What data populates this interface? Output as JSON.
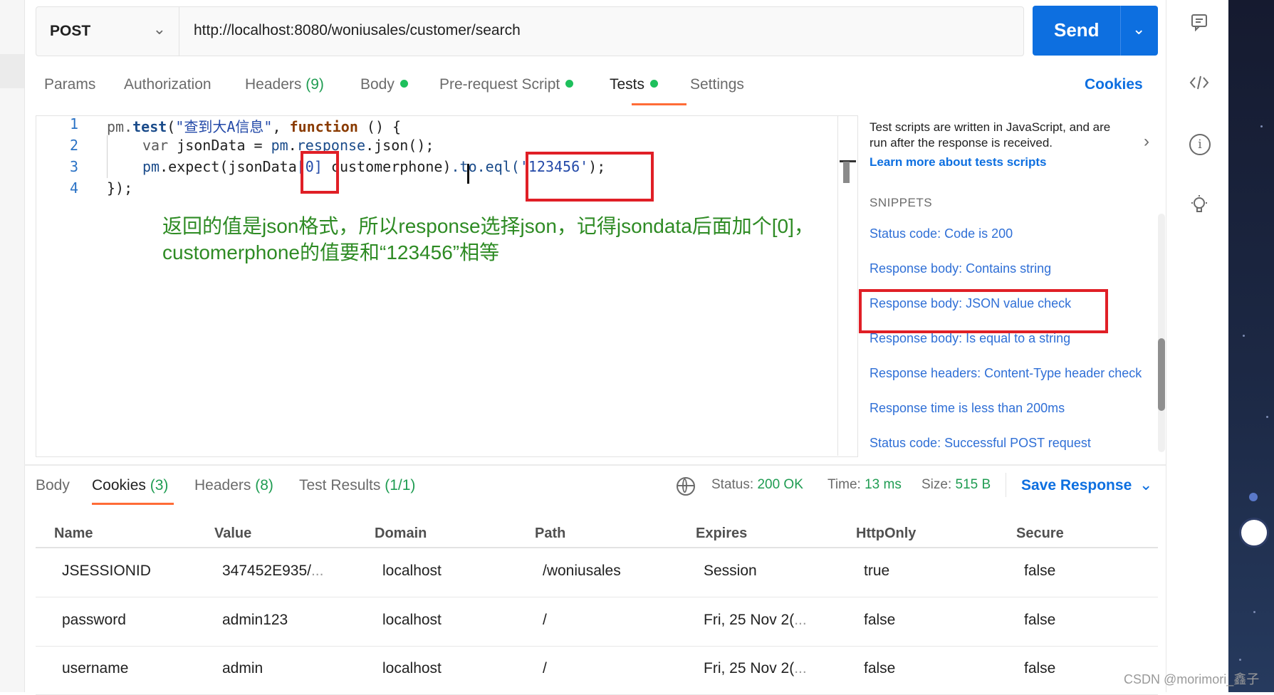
{
  "request": {
    "method": "POST",
    "url": "http://localhost:8080/woniusales/customer/search",
    "send_label": "Send"
  },
  "request_tabs": {
    "params": "Params",
    "authorization": "Authorization",
    "headers": "Headers",
    "headers_count": "(9)",
    "body": "Body",
    "prerequest": "Pre-request Script",
    "tests": "Tests",
    "settings": "Settings",
    "cookies": "Cookies"
  },
  "editor": {
    "line_numbers": [
      "1",
      "2",
      "3",
      "4"
    ],
    "line1": {
      "a": "pm.",
      "b": "test",
      "c": "(",
      "d": "\"查到大A信息\"",
      "e": ", ",
      "f": "function",
      "g": " () {"
    },
    "line2": {
      "a": "var",
      "b": " jsonData = ",
      "c": "pm",
      "d": ".",
      "e": "response",
      "f": ".json();"
    },
    "line3": {
      "a": "pm",
      "b": ".expect(jsonData",
      "c": "[0]",
      "d": " customerphone)",
      "e": ".to.eql(",
      "f": "'123456'",
      "g": ");"
    },
    "line4": "});",
    "annotation_line1": "返回的值是json格式，所以response选择json，记得jsondata后面加个[0]，",
    "annotation_line2": "customerphone的值要和“123456”相等"
  },
  "help_pane": {
    "intro": "Test scripts are written in JavaScript, and are run after the response is received.",
    "learn_more": "Learn more about tests scripts",
    "snippets_title": "SNIPPETS",
    "snippets": [
      "Status code: Code is 200",
      "Response body: Contains string",
      "Response body: JSON value check",
      "Response body: Is equal to a string",
      "Response headers: Content-Type header check",
      "Response time is less than 200ms",
      "Status code: Successful POST request"
    ]
  },
  "response": {
    "tabs": {
      "body": "Body",
      "cookies": "Cookies",
      "cookies_count": "(3)",
      "headers": "Headers",
      "headers_count": "(8)",
      "test_results": "Test Results",
      "test_results_count": "(1/1)"
    },
    "status_label": "Status:",
    "status_value": "200 OK",
    "time_label": "Time:",
    "time_value": "13 ms",
    "size_label": "Size:",
    "size_value": "515 B",
    "save_label": "Save Response"
  },
  "cookies_table": {
    "headers": [
      "Name",
      "Value",
      "Domain",
      "Path",
      "Expires",
      "HttpOnly",
      "Secure"
    ],
    "rows": [
      {
        "name": "JSESSIONID",
        "value": "347452E935/",
        "domain": "localhost",
        "path": "/woniusales",
        "expires": "Session",
        "httponly": "true",
        "secure": "false"
      },
      {
        "name": "password",
        "value": "admin123",
        "domain": "localhost",
        "path": "/",
        "expires": "Fri, 25 Nov 2(",
        "httponly": "false",
        "secure": "false"
      },
      {
        "name": "username",
        "value": "admin",
        "domain": "localhost",
        "path": "/",
        "expires": "Fri, 25 Nov 2(",
        "httponly": "false",
        "secure": "false"
      }
    ],
    "ellipsis": "..."
  },
  "icons": {
    "comments": "comment-icon",
    "code": "code-icon",
    "info": "info-icon",
    "bulb": "bulb-icon",
    "globe": "globe-icon"
  },
  "colors": {
    "accent_blue": "#0d6fe0",
    "tab_active": "#ff6c37",
    "status_green": "#1f9c52",
    "annotation_red": "#e01f26",
    "annotation_green": "#2e8b24"
  },
  "watermark": "CSDN @morimori_鑫子"
}
